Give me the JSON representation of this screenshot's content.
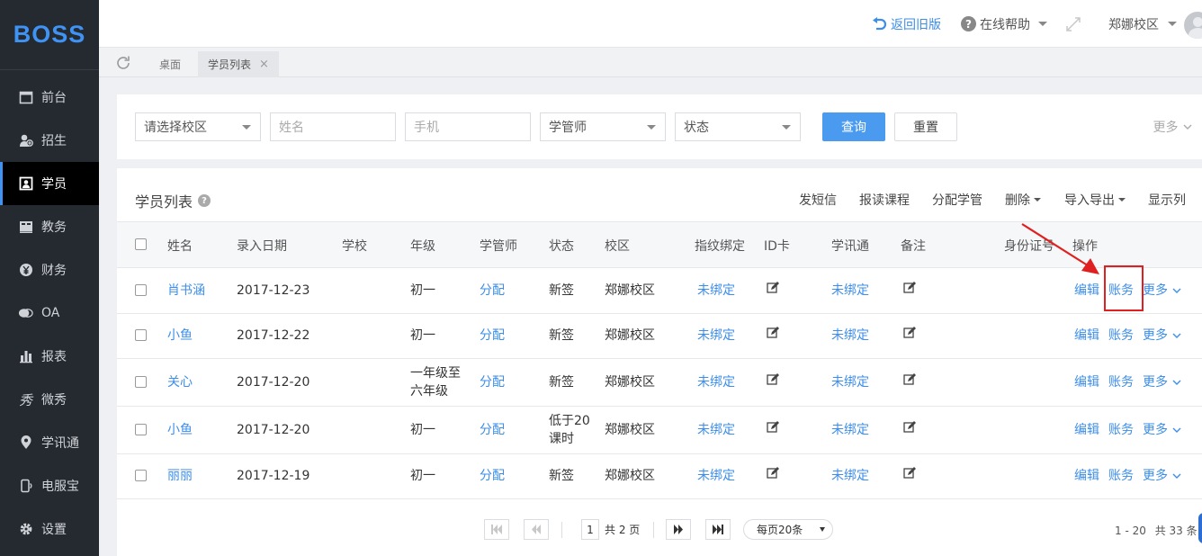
{
  "brand": {
    "logo": "BOSS"
  },
  "sidebar": {
    "items": [
      {
        "label": "前台",
        "icon": "calendar-icon"
      },
      {
        "label": "招生",
        "icon": "user-plus-icon"
      },
      {
        "label": "学员",
        "icon": "student-card-icon",
        "active": true
      },
      {
        "label": "教务",
        "icon": "book-icon"
      },
      {
        "label": "财务",
        "icon": "yen-icon"
      },
      {
        "label": "OA",
        "icon": "chat-bubble-icon"
      },
      {
        "label": "报表",
        "icon": "bar-chart-icon"
      },
      {
        "label": "微秀",
        "icon": "show-icon"
      },
      {
        "label": "学讯通",
        "icon": "location-pin-icon"
      },
      {
        "label": "电服宝",
        "icon": "phone-service-icon"
      },
      {
        "label": "设置",
        "icon": "gear-icon"
      }
    ]
  },
  "topbar": {
    "back_old": "返回旧版",
    "help": "在线帮助",
    "campus": "郑娜校区"
  },
  "tabs": [
    {
      "label": "桌面"
    },
    {
      "label": "学员列表",
      "active": true
    }
  ],
  "filters": {
    "campus_select": "请选择校区",
    "name_placeholder": "姓名",
    "phone_placeholder": "手机",
    "manager_select": "学管师",
    "status_select": "状态",
    "query_button": "查询",
    "reset_button": "重置",
    "more": "更多"
  },
  "list": {
    "title": "学员列表",
    "toolbar": [
      "发短信",
      "报读课程",
      "分配学管",
      "删除",
      "导入导出",
      "显示列"
    ],
    "columns": [
      "姓名",
      "录入日期",
      "学校",
      "年级",
      "学管师",
      "状态",
      "校区",
      "指纹绑定",
      "ID卡",
      "学讯通",
      "备注",
      "身份证号",
      "操作"
    ],
    "rows": [
      {
        "name": "肖书涵",
        "date": "2017-12-23",
        "grade": "初一",
        "manager": "分配",
        "status": "新签",
        "campus": "郑娜校区",
        "fingerprint": "未绑定",
        "xxt": "未绑定",
        "actions": [
          "编辑",
          "账务",
          "更多"
        ]
      },
      {
        "name": "小鱼",
        "date": "2017-12-22",
        "grade": "初一",
        "manager": "分配",
        "status": "新签",
        "campus": "郑娜校区",
        "fingerprint": "未绑定",
        "xxt": "未绑定",
        "actions": [
          "编辑",
          "账务",
          "更多"
        ]
      },
      {
        "name": "关心",
        "date": "2017-12-20",
        "grade": "一年级至六年级",
        "manager": "分配",
        "status": "新签",
        "campus": "郑娜校区",
        "fingerprint": "未绑定",
        "xxt": "未绑定",
        "actions": [
          "编辑",
          "账务",
          "更多"
        ]
      },
      {
        "name": "小鱼",
        "date": "2017-12-20",
        "grade": "初一",
        "manager": "分配",
        "status": "低于20课时",
        "campus": "郑娜校区",
        "fingerprint": "未绑定",
        "xxt": "未绑定",
        "actions": [
          "编辑",
          "账务",
          "更多"
        ]
      },
      {
        "name": "丽丽",
        "date": "2017-12-19",
        "grade": "初一",
        "manager": "分配",
        "status": "新签",
        "campus": "郑娜校区",
        "fingerprint": "未绑定",
        "xxt": "未绑定",
        "actions": [
          "编辑",
          "账务",
          "更多"
        ]
      }
    ]
  },
  "pagination": {
    "current_page": "1",
    "total_pages": "共 2 页",
    "page_size": "每页20条",
    "range": "1 - 20",
    "total": "共 33 条"
  },
  "colors": {
    "accent": "#3f93f5",
    "sidebar_bg": "#252a30",
    "highlight_box": "#e02020"
  }
}
